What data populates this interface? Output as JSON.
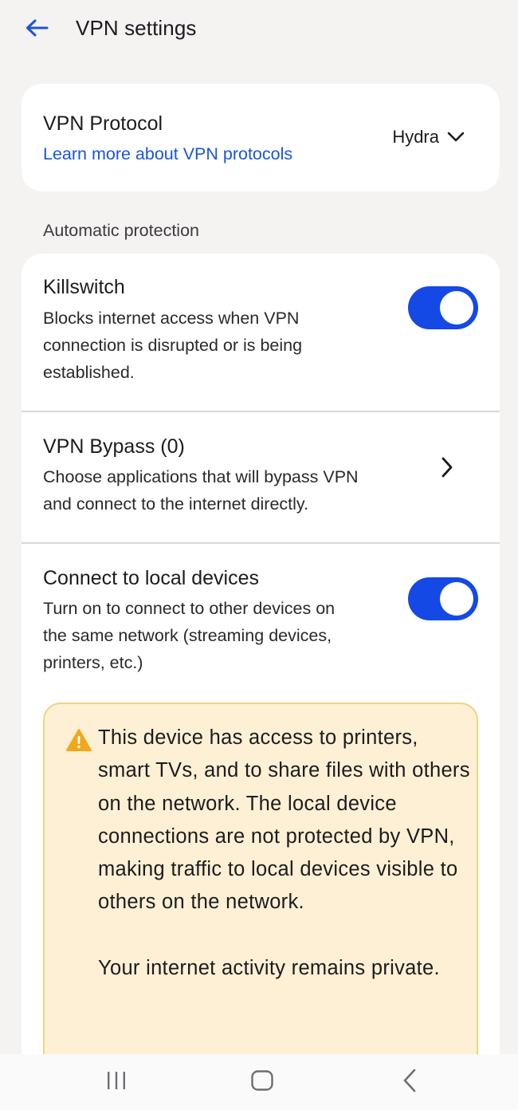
{
  "header": {
    "title": "VPN settings",
    "back_icon": "arrow-left-icon"
  },
  "protocol": {
    "title": "VPN Protocol",
    "learn_more": "Learn more about VPN protocols",
    "selected_value": "Hydra",
    "dropdown_icon": "chevron-down-icon"
  },
  "section": {
    "label": "Automatic protection"
  },
  "killswitch": {
    "title": "Killswitch",
    "desc_lines": [
      "Blocks internet access when VPN",
      "connection is disrupted or is being",
      "established."
    ],
    "enabled": true
  },
  "bypass": {
    "title": "VPN Bypass (0)",
    "desc_lines": [
      "Choose applications that will bypass VPN",
      "and connect to the internet directly."
    ],
    "icon": "chevron-right-icon"
  },
  "local_devices": {
    "title": "Connect to local devices",
    "desc_lines": [
      "Turn on to connect to other devices on",
      "the same network (streaming devices,",
      "printers, etc.)"
    ],
    "enabled": true
  },
  "warning": {
    "icon": "warning-triangle-icon",
    "paragraph1": "This device has access to printers, smart TVs, and to share files with others on the network. The local device connections are not protected by VPN, making traffic to local devices visible to others on the network.",
    "paragraph2": "Your internet activity remains private."
  },
  "nav": {
    "recents_icon": "recents-icon",
    "home_icon": "home-icon",
    "back_icon": "nav-back-icon"
  },
  "colors": {
    "accent": "#1449e6",
    "link": "#1a55d8",
    "background": "#f5f2f2",
    "warning_bg": "#fdf0d4",
    "warning_border": "#f1d287",
    "warning_icon": "#f2a71b"
  }
}
